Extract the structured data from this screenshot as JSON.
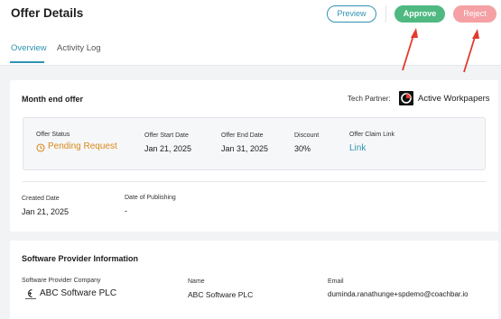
{
  "header": {
    "title": "Offer Details",
    "preview_label": "Preview",
    "approve_label": "Approve",
    "reject_label": "Reject"
  },
  "tabs": [
    {
      "label": "Overview",
      "active": true
    },
    {
      "label": "Activity Log",
      "active": false
    }
  ],
  "offer": {
    "title": "Month end offer",
    "tech_partner_label": "Tech Partner:",
    "tech_partner_name": "Active Workpapers",
    "fields": {
      "status_label": "Offer Status",
      "status_value": "Pending Request",
      "start_label": "Offer Start Date",
      "start_value": "Jan 21, 2025",
      "end_label": "Offer End Date",
      "end_value": "Jan 31, 2025",
      "discount_label": "Discount",
      "discount_value": "30%",
      "claim_label": "Offer Claim Link",
      "claim_value": "Link"
    },
    "created_label": "Created Date",
    "created_value": "Jan 21, 2025",
    "publishing_label": "Date of Publishing",
    "publishing_value": "-"
  },
  "provider": {
    "title": "Software Provider Information",
    "company_label": "Software Provider Company",
    "company_value": "ABC Software PLC",
    "name_label": "Name",
    "name_value": "ABC Software PLC",
    "email_label": "Email",
    "email_value": "duminda.ranathunge+spdemo@coachbar.io"
  },
  "colors": {
    "accent": "#2f93b3",
    "approve": "#4fb981",
    "reject": "#f4a0a4",
    "pending": "#d88a1d",
    "annotation_arrow": "#e23b2e"
  }
}
